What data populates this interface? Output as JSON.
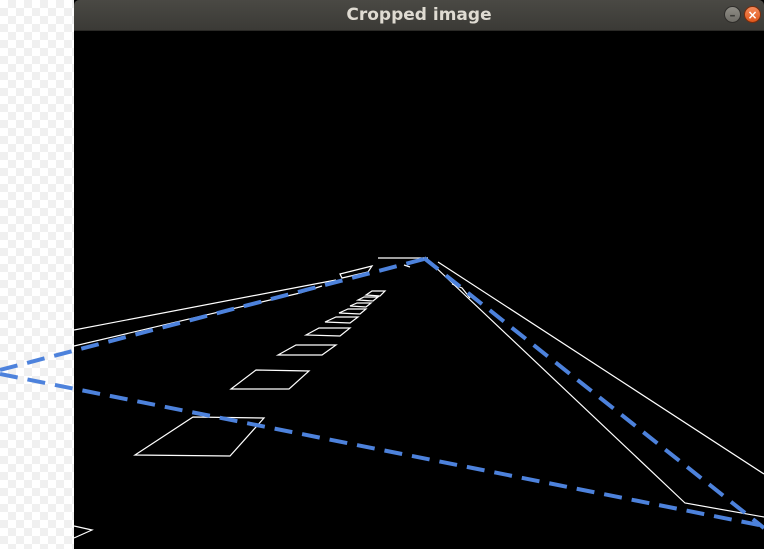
{
  "window": {
    "title": "Cropped image",
    "minimize_glyph": "–",
    "close_glyph": "×",
    "icons": [
      "minimize-icon",
      "close-icon"
    ]
  },
  "colors": {
    "background": "#000000",
    "edge_lines": "#ffffff",
    "detected_lane": "#4d82dc",
    "titlebar": "#3f3e3a",
    "close_button": "#e9622a"
  }
}
